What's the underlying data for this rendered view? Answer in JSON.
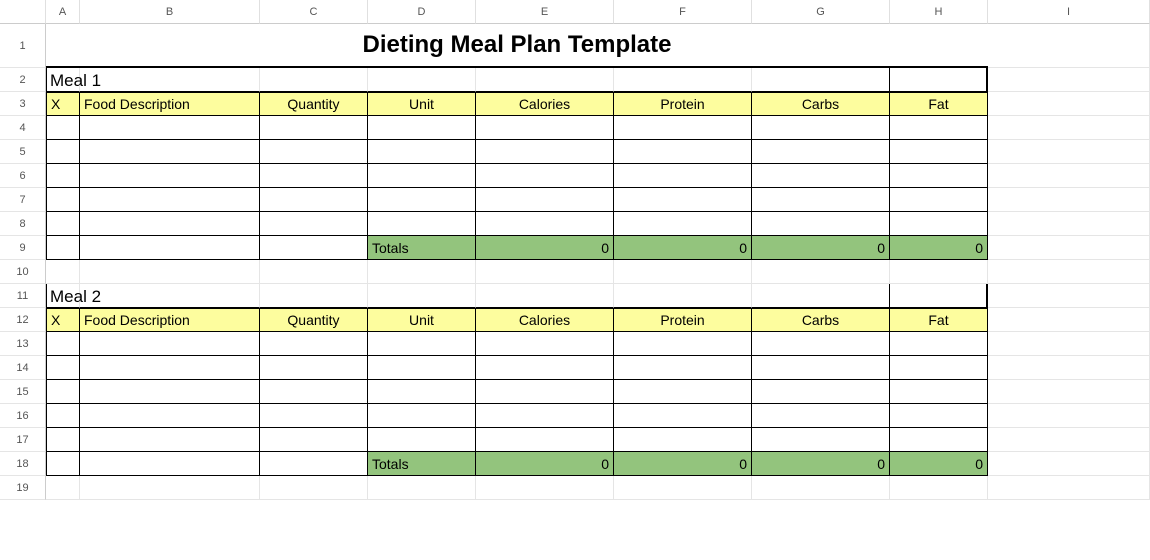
{
  "columns": [
    "A",
    "B",
    "C",
    "D",
    "E",
    "F",
    "G",
    "H",
    "I"
  ],
  "rows": [
    "1",
    "2",
    "3",
    "4",
    "5",
    "6",
    "7",
    "8",
    "9",
    "10",
    "11",
    "12",
    "13",
    "14",
    "15",
    "16",
    "17",
    "18",
    "19"
  ],
  "title": "Dieting Meal Plan Template",
  "meals": [
    {
      "label": "Meal 1",
      "header": {
        "x": "X",
        "food": "Food Description",
        "quantity": "Quantity",
        "unit": "Unit",
        "calories": "Calories",
        "protein": "Protein",
        "carbs": "Carbs",
        "fat": "Fat"
      },
      "totals": {
        "label": "Totals",
        "calories": "0",
        "protein": "0",
        "carbs": "0",
        "fat": "0"
      }
    },
    {
      "label": "Meal 2",
      "header": {
        "x": "X",
        "food": "Food Description",
        "quantity": "Quantity",
        "unit": "Unit",
        "calories": "Calories",
        "protein": "Protein",
        "carbs": "Carbs",
        "fat": "Fat"
      },
      "totals": {
        "label": "Totals",
        "calories": "0",
        "protein": "0",
        "carbs": "0",
        "fat": "0"
      }
    }
  ]
}
